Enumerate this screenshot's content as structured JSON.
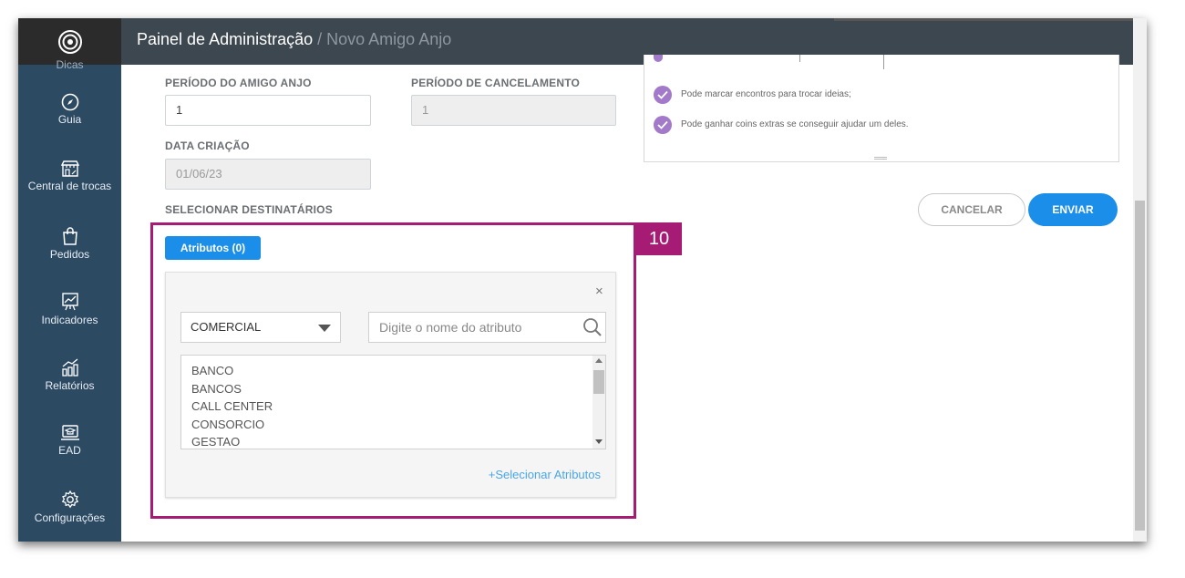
{
  "header": {
    "title": "Painel de Administração",
    "separator": " / ",
    "breadcrumb": "Novo Amigo Anjo"
  },
  "sidebar": {
    "items": [
      {
        "label": "Dicas",
        "icon": "lightbulb-icon"
      },
      {
        "label": "Guia",
        "icon": "compass-icon"
      },
      {
        "label": "Central de trocas",
        "icon": "store-icon"
      },
      {
        "label": "Pedidos",
        "icon": "shopping-bag-icon"
      },
      {
        "label": "Indicadores",
        "icon": "chart-board-icon"
      },
      {
        "label": "Relatórios",
        "icon": "bar-growth-icon"
      },
      {
        "label": "EAD",
        "icon": "laptop-cap-icon"
      },
      {
        "label": "Configurações",
        "icon": "gear-icon"
      }
    ]
  },
  "form": {
    "periodo_amigo_label": "PERÍODO DO AMIGO ANJO",
    "periodo_amigo_value": "1",
    "periodo_cancel_label": "PERÍODO DE CANCELAMENTO",
    "periodo_cancel_value": "1",
    "data_criacao_label": "DATA CRIAÇÃO",
    "data_criacao_value": "01/06/23",
    "destinatarios_label": "SELECIONAR DESTINATÁRIOS"
  },
  "info": {
    "items": [
      "Pode marcar encontros para trocar ideias;",
      "Pode ganhar coins extras se conseguir ajudar um deles."
    ]
  },
  "actions": {
    "cancel": "CANCELAR",
    "send": "ENVIAR"
  },
  "annotation": {
    "number": "10"
  },
  "attributes": {
    "tab_label": "Atributos (0)",
    "close": "×",
    "category_selected": "COMERCIAL",
    "search_placeholder": "Digite o nome do atributo",
    "options": [
      "BANCO",
      "BANCOS",
      "CALL CENTER",
      "CONSORCIO",
      "GESTAO"
    ],
    "add_link": "+Selecionar Atributos"
  },
  "colors": {
    "sidebar": "#2d4a63",
    "topbar": "#3d4750",
    "accent": "#1a8ee8",
    "annotation": "#a61c74",
    "check": "#a27ac9"
  }
}
